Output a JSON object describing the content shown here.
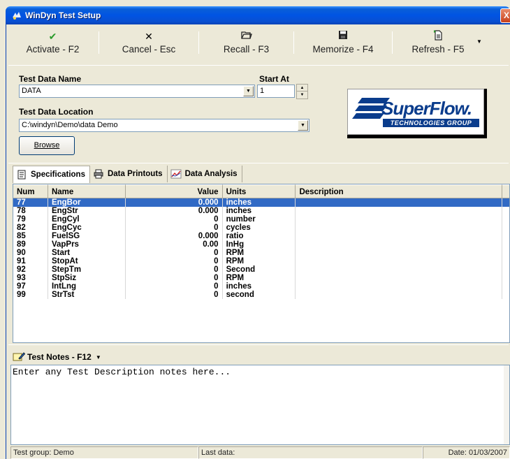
{
  "window": {
    "title": "WinDyn Test Setup",
    "close_glyph": "X"
  },
  "toolbar": {
    "buttons": [
      {
        "label": "Activate - F2",
        "icon": "checkmark-icon",
        "glyph": "✔",
        "color": "#2a9a2a"
      },
      {
        "label": "Cancel - Esc",
        "icon": "x-icon",
        "glyph": "✕",
        "color": "#333333"
      },
      {
        "label": "Recall - F3",
        "icon": "open-folder-icon",
        "glyph": "📂",
        "color": "#333333"
      },
      {
        "label": "Memorize - F4",
        "icon": "floppy-disk-icon",
        "glyph": "💾",
        "color": "#333333"
      },
      {
        "label": "Refresh - F5",
        "icon": "refresh-document-icon",
        "glyph": "📄",
        "color": "#333333"
      }
    ],
    "more_glyph": "▼"
  },
  "form": {
    "test_data_name_label": "Test Data Name",
    "test_data_name_value": "DATA",
    "start_at_label": "Start At",
    "start_at_value": "1",
    "test_data_location_label": "Test Data Location",
    "test_data_location_value": "C:\\windyn\\Demo\\data Demo",
    "browse_label": "Browse"
  },
  "logo": {
    "word": "SuperFlow.",
    "sub": "TECHNOLOGIES GROUP",
    "color": "#0a3c8c"
  },
  "tabs": [
    {
      "label": "Specifications",
      "icon": "specifications-icon",
      "active": true
    },
    {
      "label": "Data Printouts",
      "icon": "printer-icon",
      "active": false
    },
    {
      "label": "Data Analysis",
      "icon": "chart-icon",
      "active": false
    }
  ],
  "grid": {
    "columns": [
      "Num",
      "Name",
      "Value",
      "Units",
      "Description"
    ],
    "rows": [
      {
        "num": "77",
        "name": "EngBor",
        "value": "0.000",
        "units": "inches",
        "description": ""
      },
      {
        "num": "78",
        "name": "EngStr",
        "value": "0.000",
        "units": "inches",
        "description": ""
      },
      {
        "num": "79",
        "name": "EngCyl",
        "value": "0",
        "units": "number",
        "description": ""
      },
      {
        "num": "82",
        "name": "EngCyc",
        "value": "0",
        "units": "cycles",
        "description": ""
      },
      {
        "num": "85",
        "name": "FuelSG",
        "value": "0.000",
        "units": "ratio",
        "description": ""
      },
      {
        "num": "89",
        "name": "VapPrs",
        "value": "0.00",
        "units": " InHg",
        "description": ""
      },
      {
        "num": "90",
        "name": "Start",
        "value": "0",
        "units": " RPM",
        "description": ""
      },
      {
        "num": "91",
        "name": "StopAt",
        "value": "0",
        "units": " RPM",
        "description": ""
      },
      {
        "num": "92",
        "name": "StepTm",
        "value": "0",
        "units": "Second",
        "description": ""
      },
      {
        "num": "93",
        "name": "StpSiz",
        "value": "0",
        "units": " RPM",
        "description": ""
      },
      {
        "num": "97",
        "name": "IntLng",
        "value": "0",
        "units": "inches",
        "description": ""
      },
      {
        "num": "99",
        "name": "StrTst",
        "value": "0",
        "units": "second",
        "description": ""
      }
    ],
    "selected_row": 0,
    "selection_color": "#316ac5"
  },
  "notes": {
    "label": "Test Notes - F12",
    "text": "Enter any Test Description notes here..."
  },
  "status": {
    "group": "Test group: Demo",
    "last_data": "Last data:",
    "date": "Date: 01/03/2007"
  }
}
